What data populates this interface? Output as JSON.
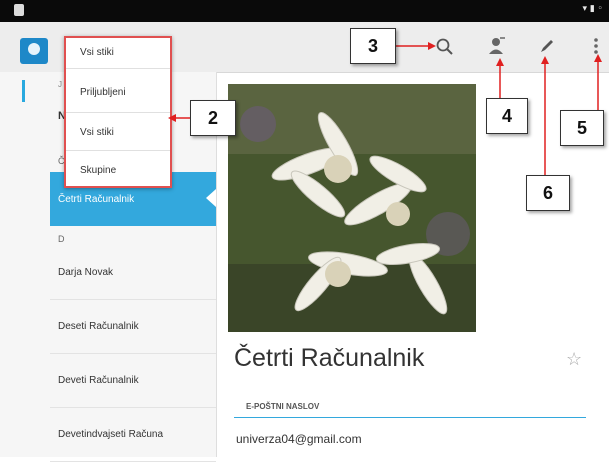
{
  "dropdown": {
    "items": [
      "Vsi stiki",
      "Priljubljeni",
      "Vsi stiki",
      "Skupine"
    ]
  },
  "sidebar": {
    "section_letters": [
      "J",
      "N",
      "Č",
      "D"
    ],
    "contacts": [
      "Četrti Računalnik",
      "Darja Novak",
      "Deseti Računalnik",
      "Deveti Računalnik",
      "Devetindvajseti Računa"
    ]
  },
  "detail": {
    "name": "Četrti Računalnik",
    "email_header": "E-POŠTNI NASLOV",
    "email": "univerza04@gmail.com"
  },
  "callouts": [
    "3",
    "2",
    "4",
    "5",
    "6"
  ],
  "icons": [
    "search-icon",
    "add-contact-icon",
    "edit-pencil-icon",
    "overflow-menu-icon",
    "star-icon",
    "app-icon"
  ],
  "colors": {
    "accent": "#33a8dd",
    "callout_line": "#e02020",
    "dropdown_border": "#e05050"
  }
}
